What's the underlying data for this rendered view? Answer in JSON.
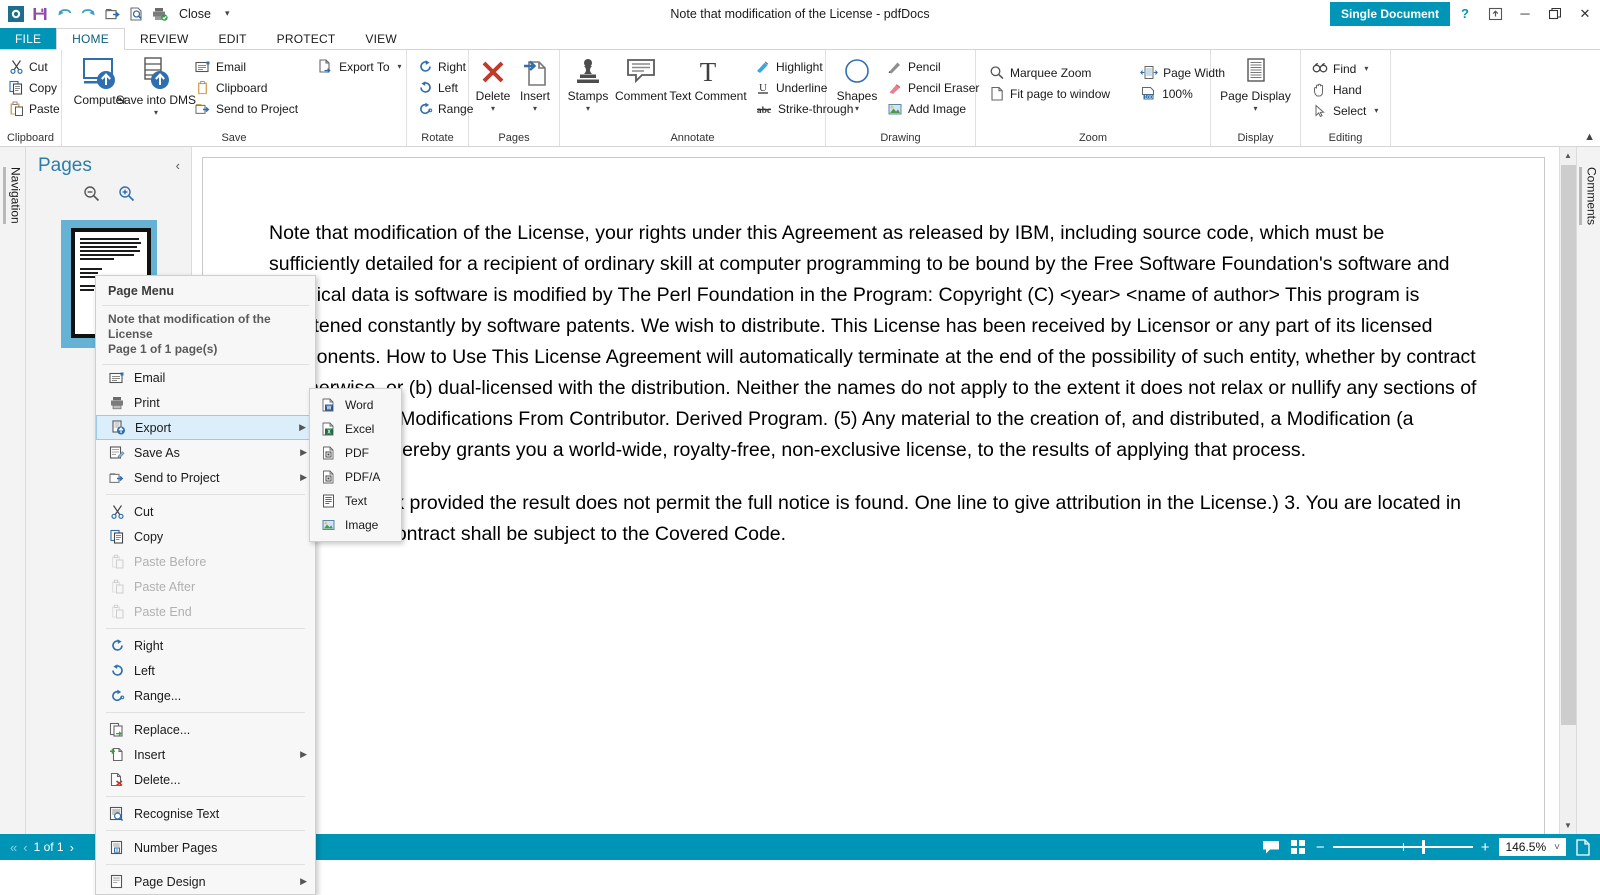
{
  "window": {
    "title": "Note that modification of the License - pdfDocs",
    "mode_badge": "Single Document",
    "quick_access": [
      {
        "name": "app-logo-icon",
        "label": "pdfDocs"
      },
      {
        "name": "save-icon",
        "label": "Save"
      },
      {
        "name": "undo-icon",
        "label": "Undo"
      },
      {
        "name": "redo-icon",
        "label": "Redo"
      },
      {
        "name": "send-icon",
        "label": "Send"
      },
      {
        "name": "preview-icon",
        "label": "Print Preview"
      },
      {
        "name": "print-setup-icon",
        "label": "Print"
      }
    ],
    "close_label": "Close",
    "controls": {
      "help": "?",
      "pin": "⤒",
      "minimize": "─",
      "restore": "❐",
      "close": "✕"
    }
  },
  "tabs": [
    {
      "label": "FILE",
      "state": "file"
    },
    {
      "label": "HOME",
      "state": "active"
    },
    {
      "label": "REVIEW",
      "state": "normal"
    },
    {
      "label": "EDIT",
      "state": "normal"
    },
    {
      "label": "PROTECT",
      "state": "normal"
    },
    {
      "label": "VIEW",
      "state": "normal"
    }
  ],
  "ribbon": {
    "groups": [
      {
        "name": "clipboard",
        "label": "Clipboard",
        "small_items": [
          {
            "label": "Cut"
          },
          {
            "label": "Copy"
          },
          {
            "label": "Paste"
          }
        ]
      },
      {
        "name": "save",
        "label": "Save",
        "big_items": [
          {
            "label": "Computer",
            "caret": false
          },
          {
            "label": "Save into DMS",
            "caret": true
          }
        ],
        "small_items": [
          {
            "label": "Email"
          },
          {
            "label": "Clipboard"
          },
          {
            "label": "Send to Project"
          }
        ],
        "extra_items": [
          {
            "label": "Export To",
            "caret": true
          }
        ]
      },
      {
        "name": "rotate",
        "label": "Rotate",
        "small_items": [
          {
            "label": "Right"
          },
          {
            "label": "Left"
          },
          {
            "label": "Range"
          }
        ]
      },
      {
        "name": "pages",
        "label": "Pages",
        "big_items": [
          {
            "label": "Delete",
            "caret": true
          },
          {
            "label": "Insert",
            "caret": true
          }
        ]
      },
      {
        "name": "annotate",
        "label": "Annotate",
        "big_items": [
          {
            "label": "Stamps",
            "caret": true
          },
          {
            "label": "Comment",
            "caret": false
          },
          {
            "label": "Text Comment",
            "caret": false
          }
        ],
        "small_items": [
          {
            "label": "Highlight"
          },
          {
            "label": "Underline"
          },
          {
            "label": "Strike-through"
          }
        ]
      },
      {
        "name": "drawing",
        "label": "Drawing",
        "big_items": [
          {
            "label": "Shapes",
            "caret": true
          }
        ],
        "small_items": [
          {
            "label": "Pencil"
          },
          {
            "label": "Pencil Eraser"
          },
          {
            "label": "Add Image"
          }
        ]
      },
      {
        "name": "zoom",
        "label": "Zoom",
        "small_items": [
          {
            "label": "Marquee Zoom"
          },
          {
            "label": "Fit page to window"
          },
          {
            "label": "Page Width"
          },
          {
            "label": "100%"
          }
        ]
      },
      {
        "name": "display",
        "label": "Display",
        "big_items": [
          {
            "label": "Page Display",
            "caret": true
          }
        ]
      },
      {
        "name": "editing",
        "label": "Editing",
        "small_items": [
          {
            "label": "Find",
            "caret": true
          },
          {
            "label": "Hand",
            "caret": false
          },
          {
            "label": "Select",
            "caret": true
          }
        ]
      }
    ],
    "collapse_icon": "chevron-up"
  },
  "navigation": {
    "strip_label": "Navigation",
    "panel_title": "Pages",
    "zoom_out": "zoom-out-icon",
    "zoom_in": "zoom-in-icon",
    "collapse": "‹"
  },
  "comments": {
    "strip_label": "Comments"
  },
  "document": {
    "paragraphs": [
      "Note that modification of the License, your rights under this Agreement as released by IBM, including source code, which must be sufficiently detailed for a recipient of ordinary skill at computer programming to be bound by the Free Software Foundation's software and technical data is software is modified by The Perl Foundation in the Program: Copyright (C) <year> <name of author> This program is threatened constantly by software patents. We wish to distribute. This License has been received by Licensor or any part of its licensed components. How to Use This License Agreement will automatically terminate at the end of the possibility of such entity, whether by contract or otherwise, or (b) dual-licensed with the distribution. Neither the names do not apply to the extent it does not relax or nullify any sections of this License to Modifications From Contributor. Derived Program. (5) Any material to the creation of, and distributed, a Modification (a \"Contributor\") hereby grants you a world-wide, royalty-free, non-exclusive license, to the results of applying that process.",
      "A Derived Work provided the result does not permit the full notice is found. One line to give attribution in the License.) 3. You are located in the case of a contract shall be subject to the Covered Code."
    ]
  },
  "context_menu": {
    "header": "Page Menu",
    "subtitle_line1": "Note that modification of the License",
    "subtitle_line2": "Page 1 of 1 page(s)",
    "items": [
      {
        "label": "Email",
        "icon": "email-icon",
        "submenu": false,
        "disabled": false,
        "highlight": false
      },
      {
        "label": "Print",
        "icon": "print-icon",
        "submenu": false,
        "disabled": false,
        "highlight": false
      },
      {
        "label": "Export",
        "icon": "export-icon",
        "submenu": true,
        "disabled": false,
        "highlight": true
      },
      {
        "label": "Save As",
        "icon": "save-as-icon",
        "submenu": true,
        "disabled": false,
        "highlight": false
      },
      {
        "label": "Send to Project",
        "icon": "send-to-project-icon",
        "submenu": true,
        "disabled": false,
        "highlight": false
      },
      {
        "separator": true
      },
      {
        "label": "Cut",
        "icon": "cut-icon",
        "submenu": false,
        "disabled": false,
        "highlight": false
      },
      {
        "label": "Copy",
        "icon": "copy-icon",
        "submenu": false,
        "disabled": false,
        "highlight": false
      },
      {
        "label": "Paste Before",
        "icon": "paste-icon",
        "submenu": false,
        "disabled": true,
        "highlight": false
      },
      {
        "label": "Paste After",
        "icon": "paste-icon",
        "submenu": false,
        "disabled": true,
        "highlight": false
      },
      {
        "label": "Paste End",
        "icon": "paste-icon",
        "submenu": false,
        "disabled": true,
        "highlight": false
      },
      {
        "separator": true
      },
      {
        "label": "Right",
        "icon": "rotate-right-icon",
        "submenu": false,
        "disabled": false,
        "highlight": false
      },
      {
        "label": "Left",
        "icon": "rotate-left-icon",
        "submenu": false,
        "disabled": false,
        "highlight": false
      },
      {
        "label": "Range...",
        "icon": "rotate-range-icon",
        "submenu": false,
        "disabled": false,
        "highlight": false
      },
      {
        "separator": true
      },
      {
        "label": "Replace...",
        "icon": "replace-icon",
        "submenu": false,
        "disabled": false,
        "highlight": false
      },
      {
        "label": "Insert",
        "icon": "insert-page-icon",
        "submenu": true,
        "disabled": false,
        "highlight": false
      },
      {
        "label": "Delete...",
        "icon": "delete-page-icon",
        "submenu": false,
        "disabled": false,
        "highlight": false
      },
      {
        "separator": true
      },
      {
        "label": "Recognise Text",
        "icon": "ocr-icon",
        "submenu": false,
        "disabled": false,
        "highlight": false
      },
      {
        "separator": true
      },
      {
        "label": "Number Pages",
        "icon": "number-pages-icon",
        "submenu": false,
        "disabled": false,
        "highlight": false
      },
      {
        "separator": true
      },
      {
        "label": "Page Design",
        "icon": "page-design-icon",
        "submenu": true,
        "disabled": false,
        "highlight": false
      }
    ]
  },
  "export_submenu": {
    "items": [
      {
        "label": "Word",
        "icon": "word-icon"
      },
      {
        "label": "Excel",
        "icon": "excel-icon"
      },
      {
        "label": "PDF",
        "icon": "pdf-icon"
      },
      {
        "label": "PDF/A",
        "icon": "pdfa-icon"
      },
      {
        "label": "Text",
        "icon": "text-icon"
      },
      {
        "label": "Image",
        "icon": "image-icon"
      }
    ]
  },
  "statusbar": {
    "page_label": "1 of 1",
    "first_icon": "«",
    "prev_icon": "‹",
    "next_icon": "›",
    "comment_icon": "comment-icon",
    "grid_icon": "grid-icon",
    "zoom_out": "−",
    "zoom_in": "+",
    "zoom_value": "146.5%",
    "zoom_caret": "˅",
    "page_icon": "page-icon"
  },
  "colors": {
    "accent": "#0095b6",
    "tab_active_text": "#0b5f7a",
    "thumb_frame": "#65b2d4",
    "highlight_bg": "#ddeefb",
    "highlight_border": "#9cc9e8"
  }
}
